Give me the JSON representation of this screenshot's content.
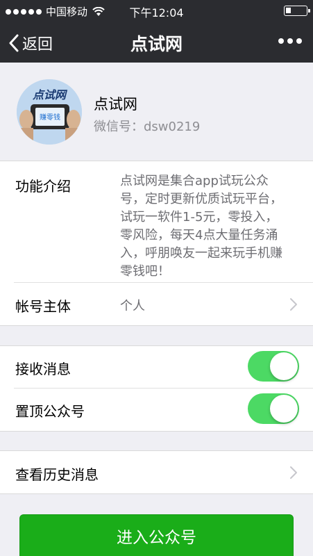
{
  "status_bar": {
    "carrier": "中国移动",
    "time": "下午12:04",
    "battery_level": 0.25,
    "signal_bars": 5
  },
  "nav": {
    "back_label": "返回",
    "title": "点试网",
    "more_icon": "more-dots-icon"
  },
  "profile": {
    "name": "点试网",
    "wechat_id": "微信号：dsw0219",
    "avatar_colors": {
      "background": "#bfd7ef",
      "accent": "#1e6fd0"
    }
  },
  "details": {
    "intro_label": "功能介绍",
    "intro_text": "点试网是集合app试玩公众号，定时更新优质试玩平台，试玩一软件1-5元，零投入，零风险，每天4点大量任务涌入，呼朋唤友一起来玩手机赚零钱吧！",
    "account_label": "帐号主体",
    "account_value": "个人"
  },
  "settings": {
    "receive_label": "接收消息",
    "receive_on": true,
    "pin_label": "置顶公众号",
    "pin_on": true
  },
  "history": {
    "label": "查看历史消息"
  },
  "enter_button": {
    "label": "进入公众号"
  },
  "colors": {
    "nav_bg": "#2b2c30",
    "toggle_on": "#4cd964",
    "primary_button": "#1aad19",
    "page_bg": "#efeff4"
  }
}
